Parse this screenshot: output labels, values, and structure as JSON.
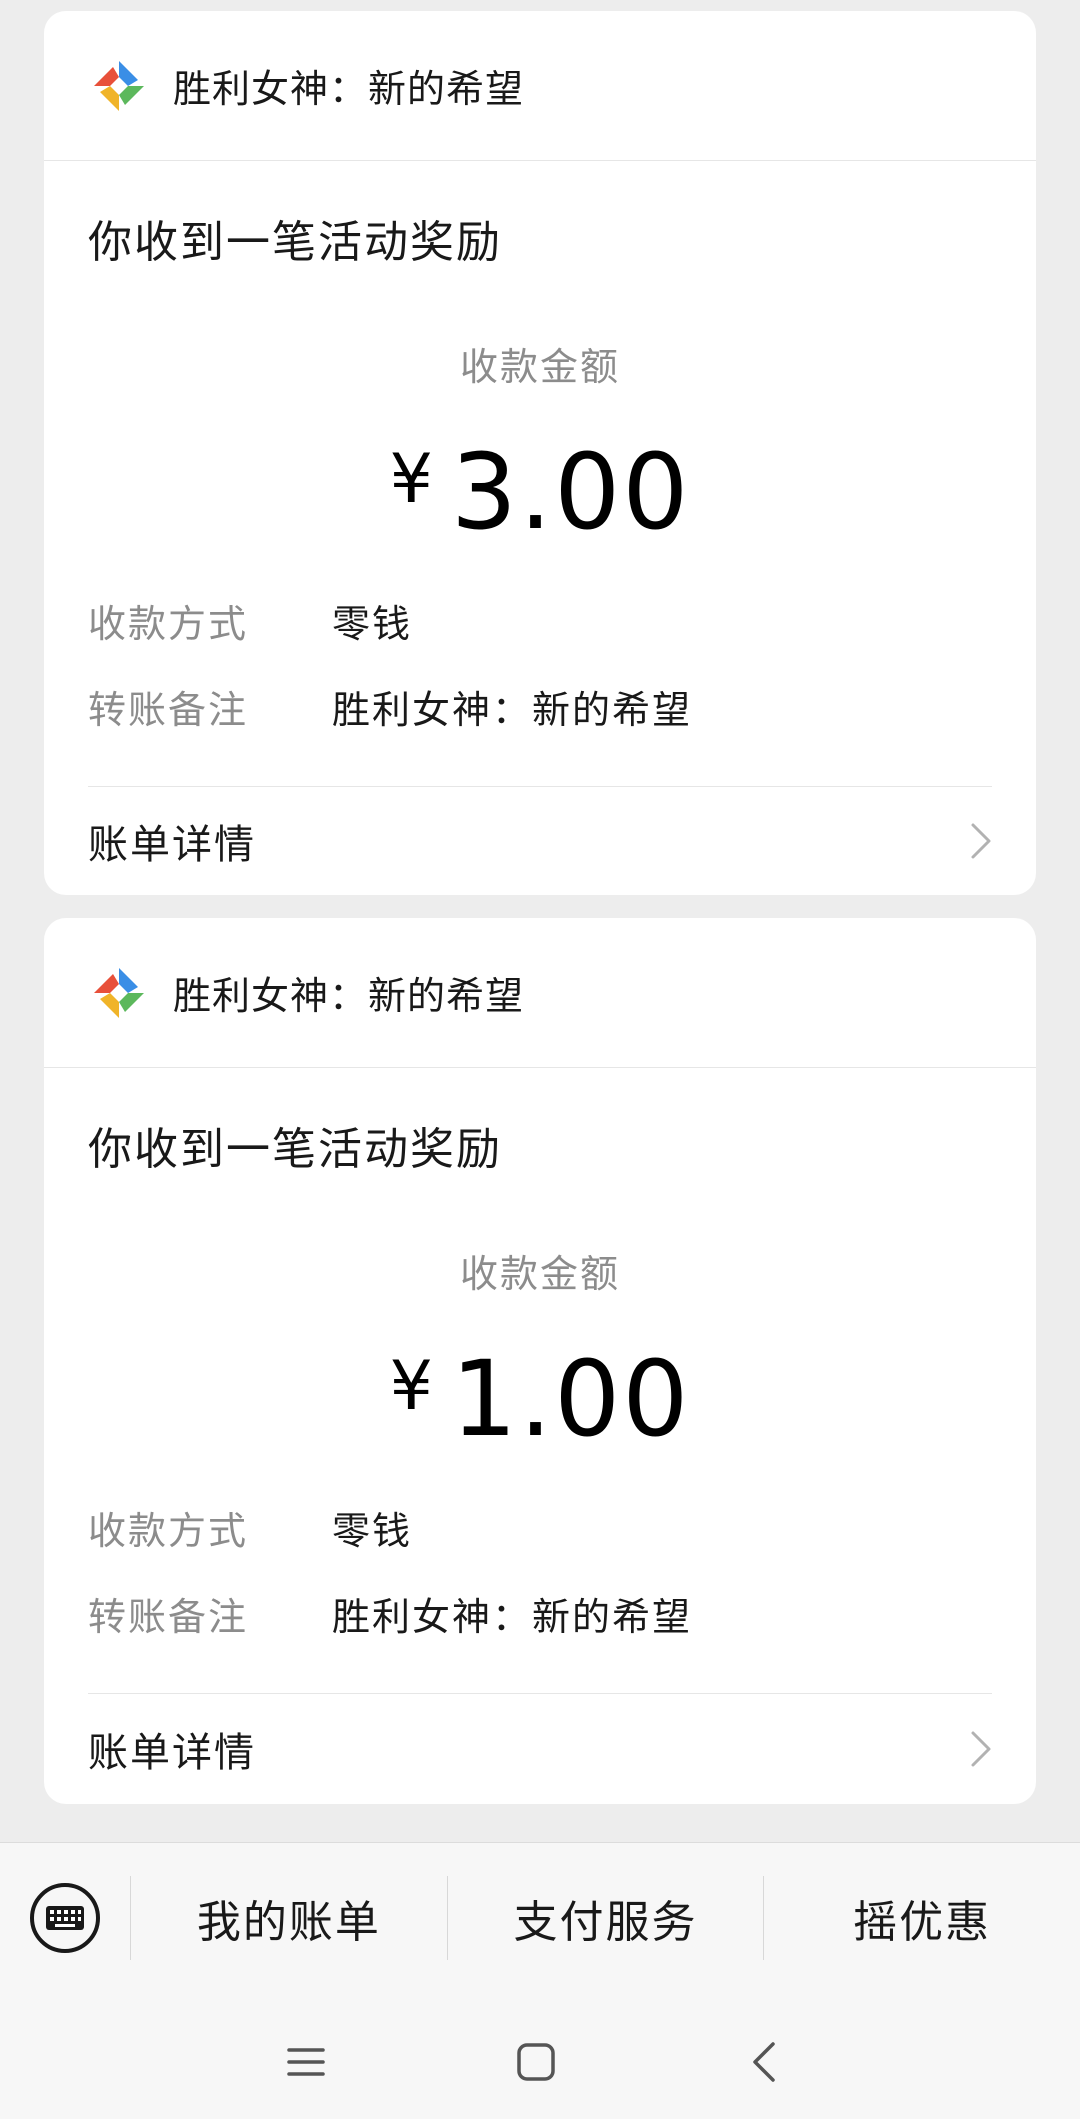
{
  "cards": [
    {
      "brand": "胜利女神：新的希望",
      "title": "你收到一笔活动奖励",
      "amount_label": "收款金额",
      "currency": "¥",
      "amount": "3.00",
      "method_label": "收款方式",
      "method_value": "零钱",
      "note_label": "转账备注",
      "note_value": "胜利女神：新的希望",
      "detail_label": "账单详情"
    },
    {
      "brand": "胜利女神：新的希望",
      "title": "你收到一笔活动奖励",
      "amount_label": "收款金额",
      "currency": "¥",
      "amount": "1.00",
      "method_label": "收款方式",
      "method_value": "零钱",
      "note_label": "转账备注",
      "note_value": "胜利女神：新的希望",
      "detail_label": "账单详情"
    }
  ],
  "menu": {
    "items": [
      "我的账单",
      "支付服务",
      "摇优惠"
    ]
  },
  "icons": {
    "keyboard": "keyboard-icon",
    "chevron": "chevron-right-icon",
    "logo": "app-logo-icon",
    "nav_menu": "menu-icon",
    "nav_home": "home-icon",
    "nav_back": "back-icon"
  }
}
